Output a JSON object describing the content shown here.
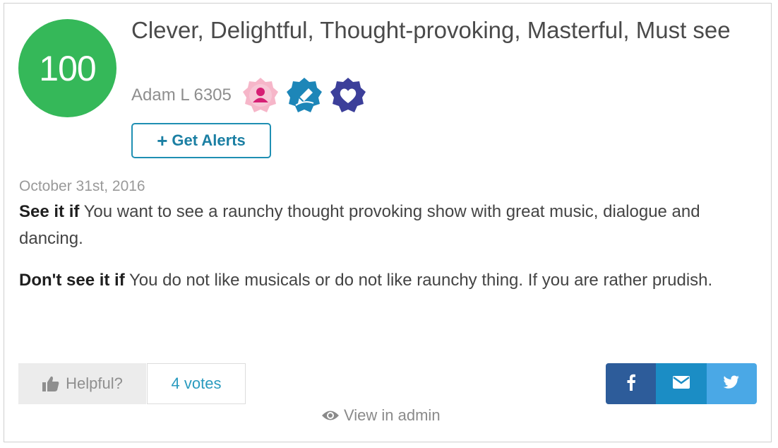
{
  "review": {
    "score": "100",
    "headline": "Clever, Delightful, Thought-provoking, Masterful, Must see",
    "author": "Adam L 6305",
    "badges": [
      "reviewer-badge-icon",
      "critic-pen-badge-icon",
      "heart-badge-icon"
    ],
    "alerts_label": "Get Alerts",
    "date": "October 31st, 2016",
    "see_it_if_label": "See it if",
    "see_it_if_text": " You want to see a raunchy thought provoking show with great music, dialogue and dancing.",
    "dont_see_it_if_label": "Don't see it if",
    "dont_see_it_if_text": " You do not like musicals or do not like raunchy thing. If you are rather prudish."
  },
  "actions": {
    "helpful_label": "Helpful?",
    "votes_label": "4 votes",
    "view_admin_label": "View in admin",
    "share_icons": [
      "facebook-icon",
      "email-icon",
      "twitter-icon"
    ]
  },
  "colors": {
    "score_green": "#35b859",
    "accent_blue": "#1f8fb3",
    "facebook": "#2d5c9a",
    "email": "#1b8dc5",
    "twitter": "#4aa8e6"
  }
}
